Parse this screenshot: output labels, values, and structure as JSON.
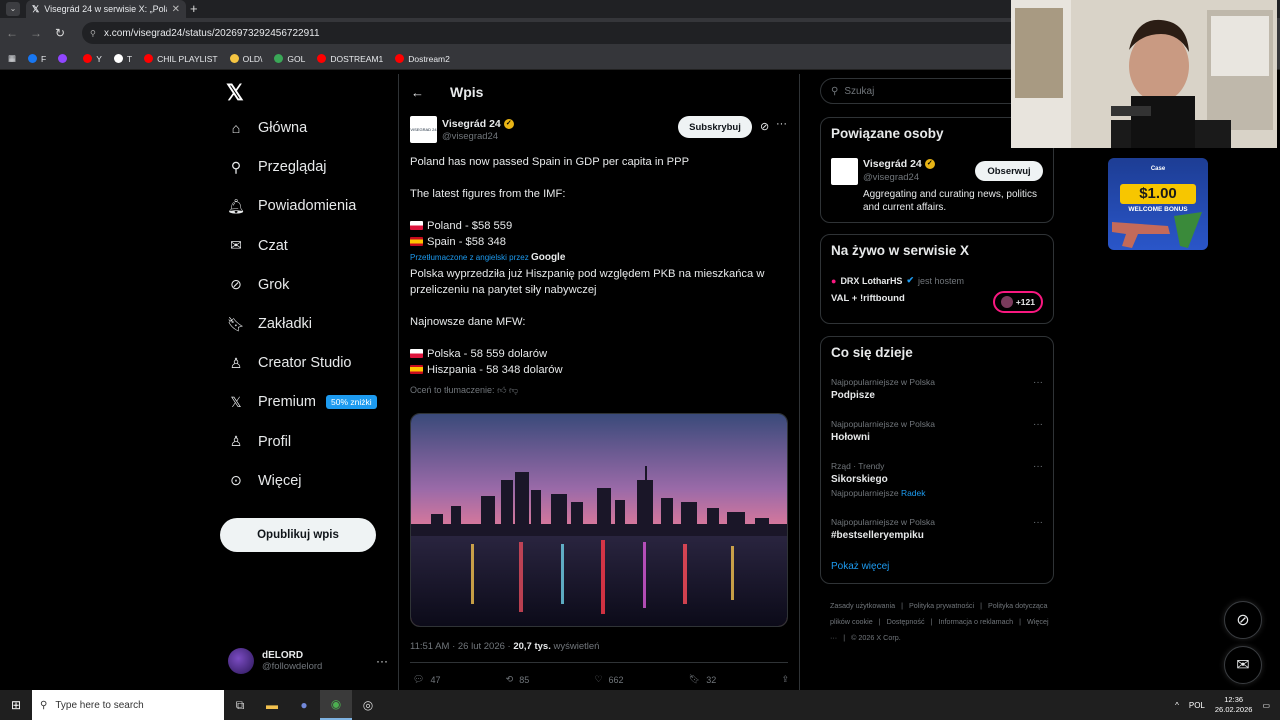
{
  "browser": {
    "tab_title": "Visegrád 24 w serwisie X: „Pola",
    "url": "x.com/visegrad24/status/2026973292456722911",
    "bookmarks": [
      {
        "label": "F",
        "color": "#1877f2"
      },
      {
        "label": "",
        "color": "#9146ff"
      },
      {
        "label": "Y",
        "color": "#ff0000"
      },
      {
        "label": "T",
        "color": "#ffffff"
      },
      {
        "label": "CHIL PLAYLIST",
        "color": "#ff0000"
      },
      {
        "label": "OLD\\",
        "color": "#f5c542"
      },
      {
        "label": "GOL",
        "color": "#3aa757"
      },
      {
        "label": "DOSTREAM1",
        "color": "#ff0000"
      },
      {
        "label": "Dostream2",
        "color": "#ff0000"
      }
    ]
  },
  "nav": {
    "items": [
      {
        "label": "Główna",
        "icon": "home-icon"
      },
      {
        "label": "Przeglądaj",
        "icon": "search-icon"
      },
      {
        "label": "Powiadomienia",
        "icon": "bell-icon"
      },
      {
        "label": "Czat",
        "icon": "mail-icon"
      },
      {
        "label": "Grok",
        "icon": "grok-icon"
      },
      {
        "label": "Zakładki",
        "icon": "bookmark-icon"
      },
      {
        "label": "Creator Studio",
        "icon": "creator-icon"
      },
      {
        "label": "Premium",
        "icon": "x-icon"
      },
      {
        "label": "Profil",
        "icon": "person-icon"
      },
      {
        "label": "Więcej",
        "icon": "more-circle-icon"
      }
    ],
    "premium_badge": "50% zniżki",
    "publish_label": "Opublikuj wpis",
    "me_name": "dELORD",
    "me_handle": "@followdelord"
  },
  "post": {
    "header_title": "Wpis",
    "author_name": "Visegrád 24",
    "author_handle": "@visegrad24",
    "avatar_text": "VISEGRAD 24",
    "subscribe_label": "Subskrybuj",
    "line1": "Poland has now passed Spain in GDP per capita in PPP",
    "line2": "The latest figures from the IMF:",
    "line3": "Poland - $58 559",
    "line4": "Spain - $58 348",
    "translated_by": "Przetłumaczone z angielski przez",
    "translated_brand": "Google",
    "tr1": "Polska wyprzedziła już Hiszpanię pod względem PKB na mieszkańca w przeliczeniu na parytet siły nabywczej",
    "tr2": "Najnowsze dane MFW:",
    "tr3": "Polska - 58 559 dolarów",
    "tr4": "Hiszpania - 58 348 dolarów",
    "rate_label": "Oceń to tłumaczenie:",
    "time": "11:51 AM · 26 lut 2026 · ",
    "views": "20,7 tys.",
    "views_label": " wyświetleń",
    "replies": "47",
    "reposts": "85",
    "likes": "662",
    "bookmarks": "32"
  },
  "right": {
    "search_placeholder": "Szukaj",
    "related_title": "Powiązane osoby",
    "related_name": "Visegrád 24",
    "related_handle": "@visegrad24",
    "related_desc": "Aggregating and curating news, politics and current affairs.",
    "follow_label": "Obserwuj",
    "live_title": "Na żywo w serwisie X",
    "live_host": "DRX LotharHS",
    "live_host_suffix": "jest hostem",
    "live_title_text": "VAL + !riftbound",
    "live_count": "+121",
    "happening_title": "Co się dzieje",
    "trends": [
      {
        "cat": "Najpopularniejsze w Polska",
        "name": "Podpisze",
        "sub_prefix": "",
        "sub_link": ""
      },
      {
        "cat": "Najpopularniejsze w Polska",
        "name": "Hołowni",
        "sub_prefix": "",
        "sub_link": ""
      },
      {
        "cat": "Rząd · Trendy",
        "name": "Sikorskiego",
        "sub_prefix": "Najpopularniejsze ",
        "sub_link": "Radek"
      },
      {
        "cat": "Najpopularniejsze w Polska",
        "name": "#bestselleryempiku",
        "sub_prefix": "",
        "sub_link": ""
      }
    ],
    "show_more": "Pokaż więcej",
    "footer": [
      "Zasady użytkowania",
      "|",
      "Polityka prywatności",
      "|",
      "Polityka dotycząca plików cookie",
      "|",
      "Dostępność",
      "|",
      "Informacja o reklamach",
      "|",
      "Więcej ···",
      "|",
      "© 2026 X Corp."
    ]
  },
  "ad": {
    "brand": "Case",
    "price": "$1.00",
    "bonus": "WELCOME BONUS"
  },
  "taskbar": {
    "search_placeholder": "Type here to search",
    "lang": "POL",
    "time": "12:36",
    "date": "26.02.2026"
  }
}
